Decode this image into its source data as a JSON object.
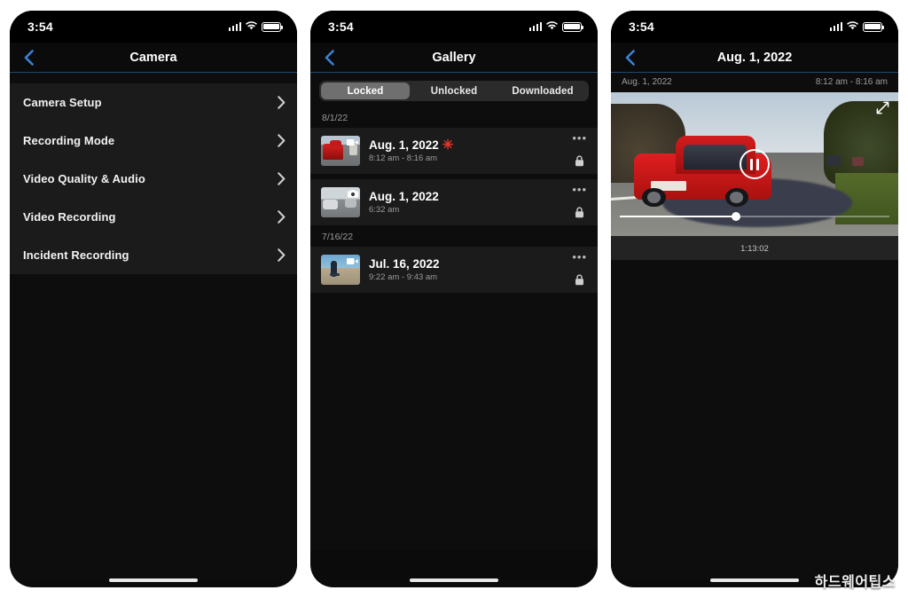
{
  "watermark": "하드웨어팁스",
  "phone1": {
    "status": {
      "time": "3:54",
      "signal_icon": "signal-bars-icon",
      "wifi_icon": "wifi-icon",
      "battery_icon": "battery-full-icon"
    },
    "nav": {
      "back_icon": "chevron-left-icon",
      "title": "Camera"
    },
    "settings": [
      {
        "label": "Camera Setup",
        "chevron": "chevron-right-icon"
      },
      {
        "label": "Recording Mode",
        "chevron": "chevron-right-icon"
      },
      {
        "label": "Video Quality & Audio",
        "chevron": "chevron-right-icon"
      },
      {
        "label": "Video Recording",
        "chevron": "chevron-right-icon"
      },
      {
        "label": "Incident Recording",
        "chevron": "chevron-right-icon"
      }
    ]
  },
  "phone2": {
    "status": {
      "time": "3:54",
      "signal_icon": "signal-bars-icon",
      "wifi_icon": "wifi-icon",
      "battery_icon": "battery-full-icon"
    },
    "nav": {
      "back_icon": "chevron-left-icon",
      "title": "Gallery"
    },
    "segments": [
      {
        "label": "Locked",
        "selected": true
      },
      {
        "label": "Unlocked",
        "selected": false
      },
      {
        "label": "Downloaded",
        "selected": false
      }
    ],
    "groups": [
      {
        "date_header": "8/1/22",
        "items": [
          {
            "title": "Aug. 1, 2022",
            "subtitle": "8:12 am - 8:16 am",
            "flag": "✳",
            "media_type": "video",
            "badge_icon": "video-camera-icon",
            "more_icon": "more-horizontal-icon",
            "lock_icon": "lock-closed-icon"
          },
          {
            "title": "Aug. 1, 2022",
            "subtitle": "6:32 am",
            "flag": "",
            "media_type": "photo",
            "badge_icon": "photo-camera-icon",
            "more_icon": "more-horizontal-icon",
            "lock_icon": "lock-closed-icon"
          }
        ]
      },
      {
        "date_header": "7/16/22",
        "items": [
          {
            "title": "Jul. 16, 2022",
            "subtitle": "9:22 am - 9:43 am",
            "flag": "",
            "media_type": "video",
            "badge_icon": "video-camera-icon",
            "more_icon": "more-horizontal-icon",
            "lock_icon": "lock-closed-icon"
          }
        ]
      }
    ]
  },
  "phone3": {
    "status": {
      "time": "3:54",
      "signal_icon": "signal-bars-icon",
      "wifi_icon": "wifi-icon",
      "battery_icon": "battery-full-icon"
    },
    "nav": {
      "back_icon": "chevron-left-icon",
      "title": "Aug. 1, 2022"
    },
    "clip_header": {
      "date": "Aug. 1, 2022",
      "time_range": "8:12 am - 8:16 am"
    },
    "player": {
      "expand_icon": "expand-arrows-icon",
      "pause_icon": "pause-icon",
      "progress_percent": 43,
      "timestamp": "1:13:02"
    }
  },
  "colors": {
    "accent_blue": "#3b82d6",
    "divider_blue": "#1d4a78",
    "flag_red": "#e8372a",
    "panel": "#1b1b1b",
    "background": "#0d0d0d",
    "segment_selected": "#6f6f6f"
  }
}
